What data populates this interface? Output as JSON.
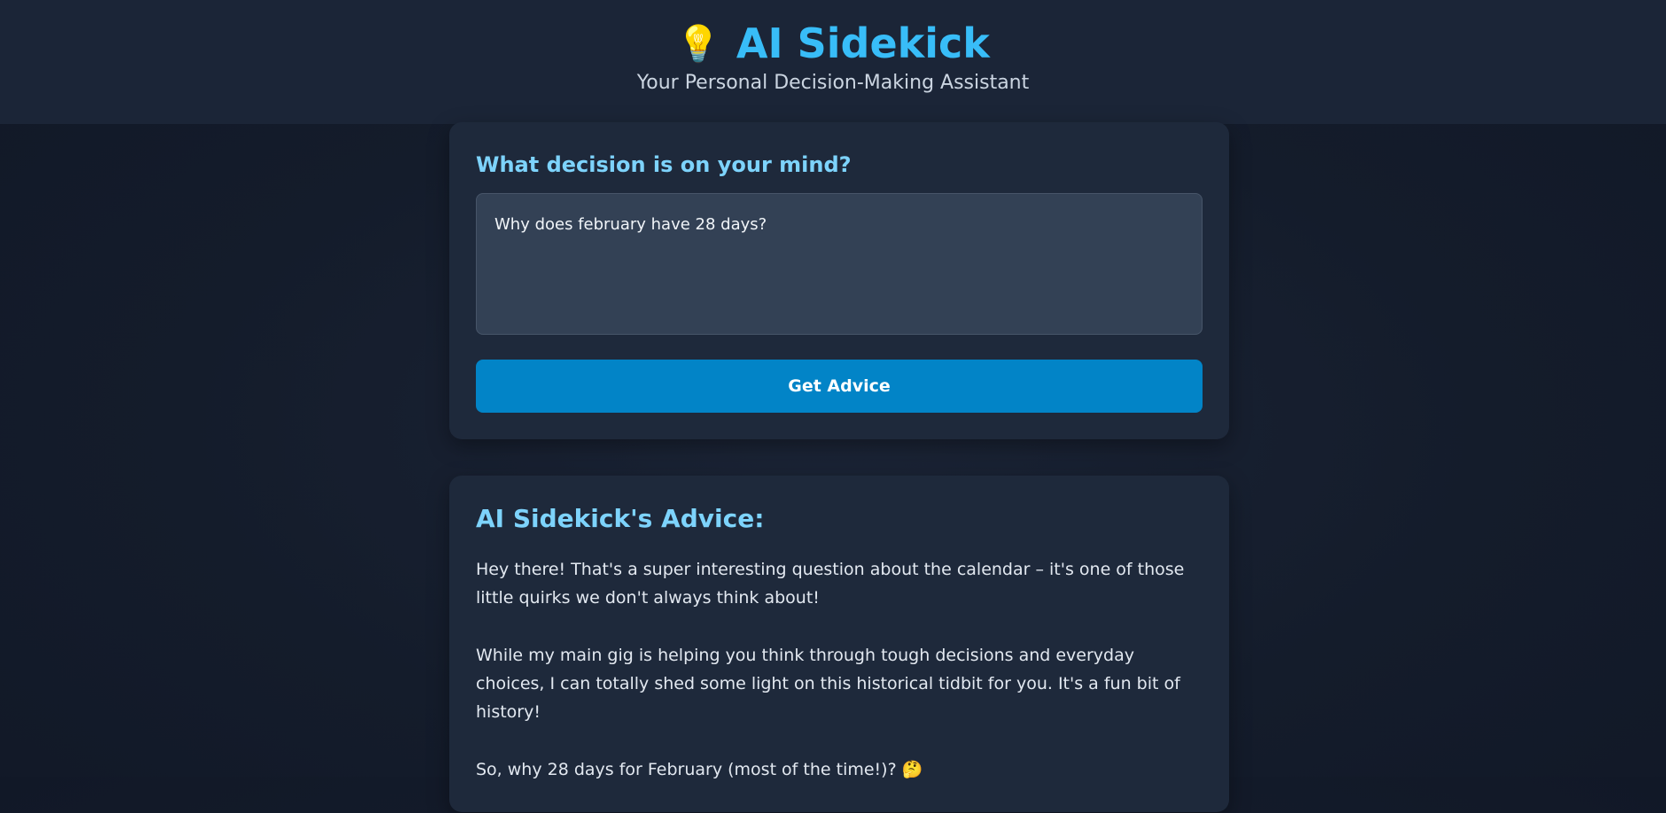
{
  "header": {
    "icon": "lightbulb-icon",
    "icon_glyph": "💡",
    "title": "AI Sidekick",
    "subtitle": "Your Personal Decision-Making Assistant"
  },
  "input_card": {
    "label": "What decision is on your mind?",
    "question_value": "Why does february have 28 days?",
    "button_label": "Get Advice"
  },
  "advice_card": {
    "heading": "AI Sidekick's Advice:",
    "paragraphs": [
      "Hey there! That's a super interesting question about the calendar – it's one of those little quirks we don't always think about!",
      "While my main gig is helping you think through tough decisions and everyday choices, I can totally shed some light on this historical tidbit for you. It's a fun bit of history!",
      "So, why 28 days for February (most of the time!)?"
    ],
    "emoji_icon": "thinking-face-icon",
    "emoji_glyph": "🤔"
  },
  "colors": {
    "accent": "#38bdf8",
    "heading": "#7dd3fc",
    "button": "#0284c7",
    "card": "#1e293b",
    "header_bg": "#1b2537"
  }
}
